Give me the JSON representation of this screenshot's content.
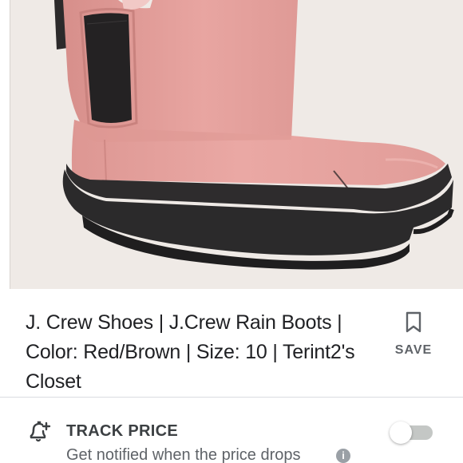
{
  "product": {
    "image_alt": "Pink rubber chelsea rain boot",
    "title": "J. Crew Shoes | J.Crew Rain Boots | Color: Red/Brown | Size: 10 | Terint2's Closet",
    "save_label": "SAVE",
    "save_icon": "bookmark-icon"
  },
  "track_price": {
    "icon": "price-alert-icon",
    "title": "TRACK PRICE",
    "subtitle": "Get notified when the price drops",
    "info_icon_glyph": "i",
    "toggle_on": false
  },
  "colors": {
    "boot_pink": "#e7a3a0",
    "boot_sole": "#2e2c2d",
    "background": "#efeae6"
  }
}
